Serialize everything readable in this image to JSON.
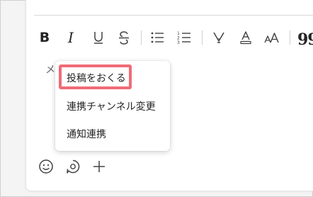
{
  "toolbar": {
    "bold_label": "B",
    "italic_label": "I",
    "quote_label": "99",
    "icons": [
      "bold-icon",
      "italic-icon",
      "underline-icon",
      "strikethrough-icon",
      "bulleted-list-icon",
      "numbered-list-icon",
      "highlight-icon",
      "font-color-icon",
      "font-size-icon",
      "quote-icon"
    ]
  },
  "compose": {
    "placeholder_visible": "メ"
  },
  "context_menu": {
    "items": [
      {
        "label": "投稿をおくる",
        "highlighted": true
      },
      {
        "label": "連携チャンネル変更",
        "highlighted": false
      },
      {
        "label": "通知連携",
        "highlighted": false
      }
    ]
  },
  "bottom_bar": {
    "icons": [
      "emoji-icon",
      "loop-component-icon",
      "add-icon"
    ]
  },
  "colors": {
    "highlight_border": "#f06b76",
    "icon": "#424242",
    "text": "#242424"
  }
}
